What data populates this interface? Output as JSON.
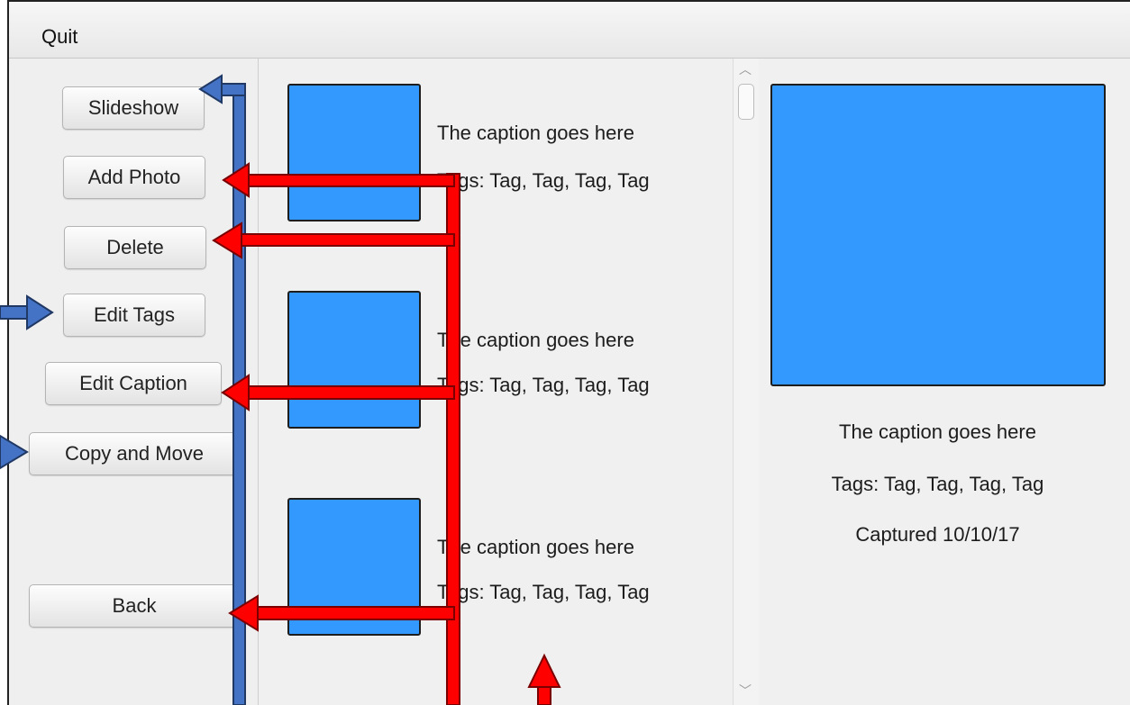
{
  "menu": {
    "quit_label": "Quit"
  },
  "buttons": {
    "slideshow": "Slideshow",
    "add_photo": "Add Photo",
    "delete": "Delete",
    "edit_tags": "Edit Tags",
    "edit_caption": "Edit Caption",
    "copy_and_move": "Copy and Move",
    "back": "Back"
  },
  "photo_list": [
    {
      "caption": "The caption goes here",
      "tags": "Tags: Tag, Tag, Tag, Tag"
    },
    {
      "caption": "The caption goes here",
      "tags": "Tags: Tag, Tag, Tag, Tag"
    },
    {
      "caption": "The caption goes here",
      "tags": "Tags: Tag, Tag, Tag, Tag"
    }
  ],
  "detail": {
    "caption": "The caption goes here",
    "tags": "Tags: Tag, Tag, Tag, Tag",
    "captured": "Captured 10/10/17"
  },
  "colors": {
    "thumbnail_fill": "#3399ff",
    "annotation_red": "#ff0000",
    "annotation_blue": "#4472c4"
  },
  "icons": {
    "scroll_up": "chevron-up-icon",
    "scroll_down": "chevron-down-icon"
  }
}
